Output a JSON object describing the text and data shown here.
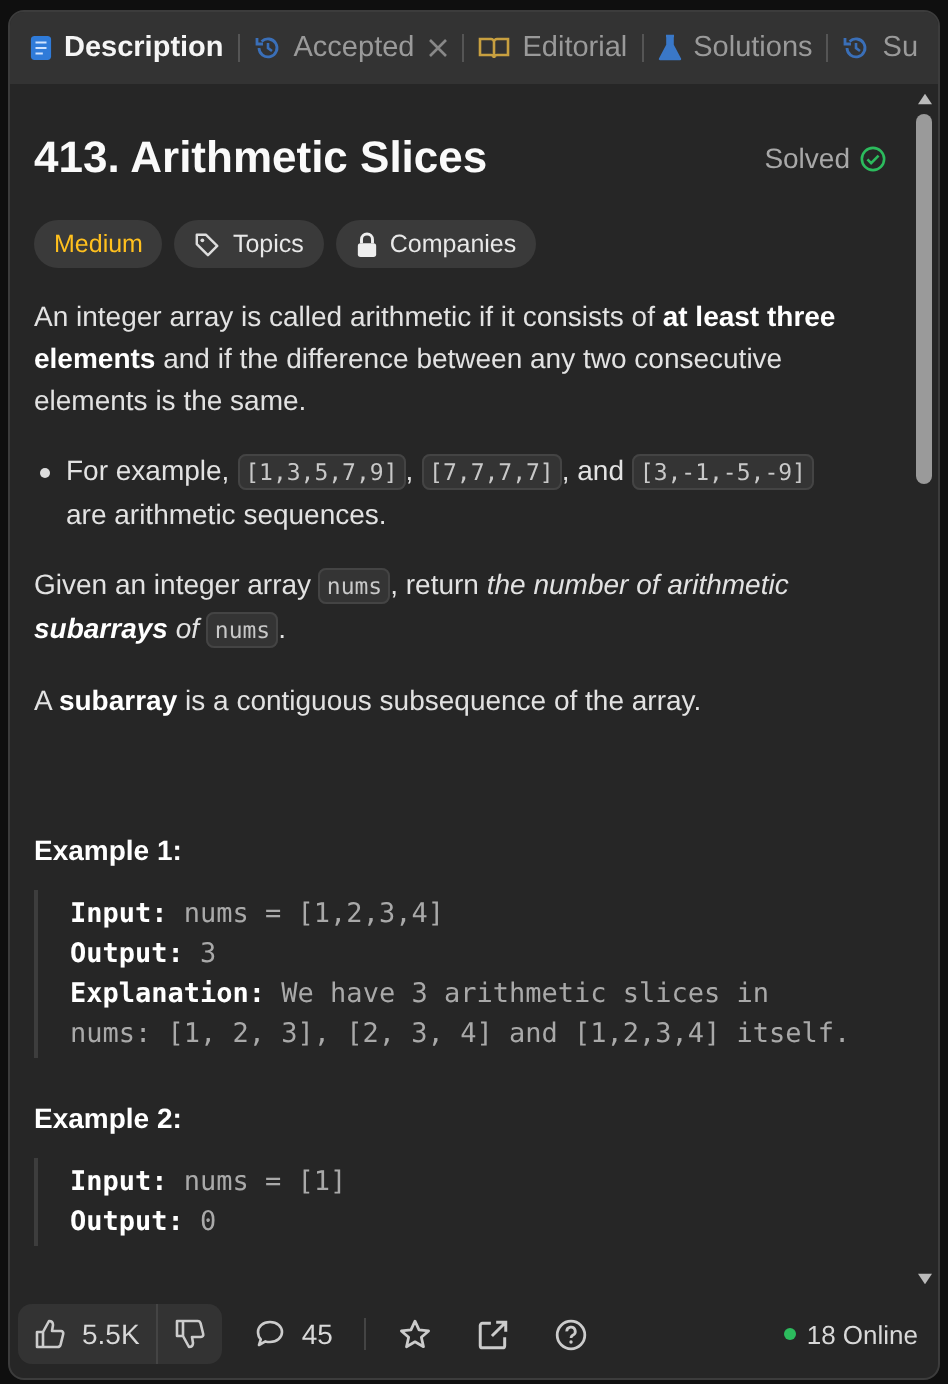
{
  "tabs": [
    {
      "label": "Description",
      "selected": true,
      "closable": false
    },
    {
      "label": "Accepted",
      "selected": false,
      "closable": true
    },
    {
      "label": "Editorial",
      "selected": false,
      "closable": false
    },
    {
      "label": "Solutions",
      "selected": false,
      "closable": false
    },
    {
      "label": "Su",
      "selected": false,
      "closable": false
    }
  ],
  "problem": {
    "title": "413. Arithmetic Slices",
    "status": "Solved",
    "solved": true,
    "tags": [
      {
        "label": "Medium",
        "kind": "difficulty"
      },
      {
        "label": "Topics",
        "kind": "topics"
      },
      {
        "label": "Companies",
        "kind": "companies"
      }
    ]
  },
  "content": [
    {
      "kind": "paragraph",
      "parts": [
        {
          "kind": "text",
          "text": "An integer array is called arithmetic if it consists of **at least three elements** and if the difference between any two consecutive elements is the same."
        }
      ]
    },
    {
      "kind": "bullet",
      "parts": [
        {
          "kind": "text",
          "text": "For example, "
        },
        {
          "kind": "code",
          "text": "[1,3,5,7,9]"
        },
        {
          "kind": "text",
          "text": ", "
        },
        {
          "kind": "code",
          "text": "[7,7,7,7]"
        },
        {
          "kind": "text",
          "text": ", and "
        },
        {
          "kind": "code",
          "text": "[3,-1,-5,-9]"
        },
        {
          "kind": "text",
          "text": " are arithmetic sequences."
        }
      ]
    },
    {
      "kind": "paragraph",
      "parts": [
        {
          "kind": "text",
          "text": "Given an integer array "
        },
        {
          "kind": "code",
          "text": "nums"
        },
        {
          "kind": "text",
          "text": ", return "
        },
        {
          "kind": "italic",
          "text": "the number of arithmetic **subarrays** of "
        },
        {
          "kind": "code",
          "text": "nums"
        },
        {
          "kind": "text",
          "text": "."
        }
      ]
    },
    {
      "kind": "paragraph",
      "parts": [
        {
          "kind": "text",
          "text": "A **subarray** is a contiguous subsequence of the array."
        }
      ]
    }
  ],
  "examples": [
    {
      "title": "Example 1:",
      "lines": [
        "**Input:** nums = [1,2,3,4]",
        "**Output:** 3",
        "**Explanation:** We have 3 arithmetic slices in nums: [1, 2, 3], [2, 3, 4] and [1,2,3,4] itself."
      ]
    },
    {
      "title": "Example 2:",
      "lines": [
        "**Input:** nums = [1]",
        "**Output:** 0"
      ]
    }
  ],
  "footer": {
    "likes": "5.5K",
    "comments": "45",
    "online": "18 Online"
  }
}
